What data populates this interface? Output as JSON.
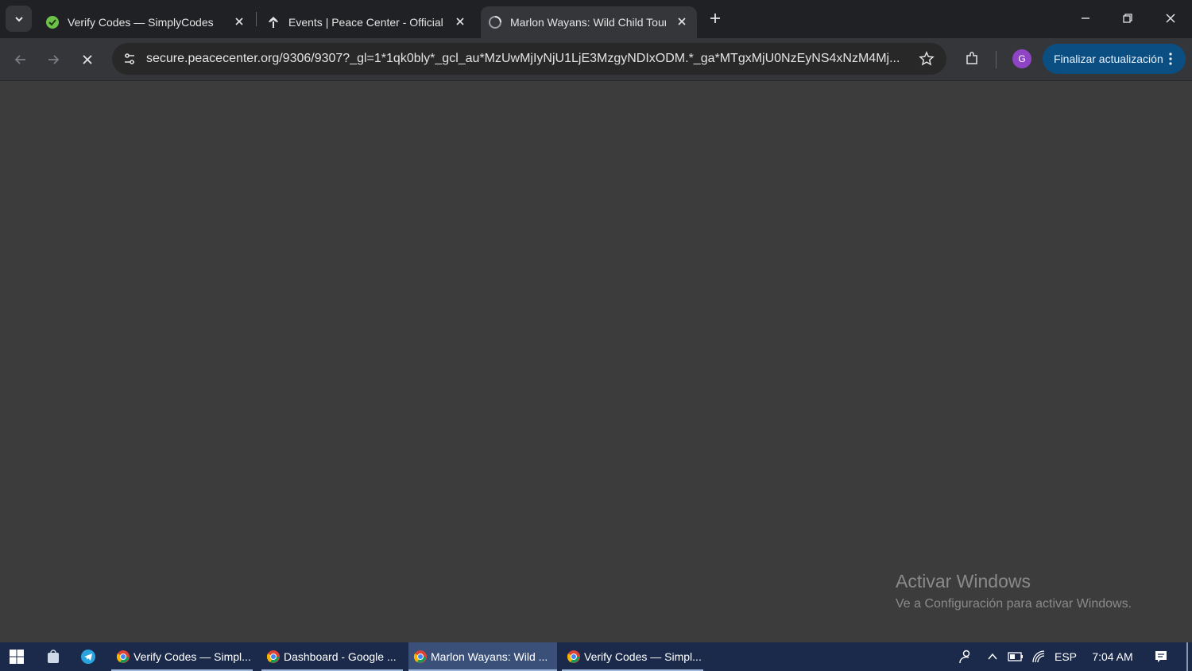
{
  "browser": {
    "tabs": [
      {
        "title": "Verify Codes — SimplyCodes",
        "favicon": "simplycodes-icon",
        "active": false
      },
      {
        "title": "Events | Peace Center - Official Site",
        "favicon": "peace-center-icon",
        "active": false
      },
      {
        "title": "Marlon Wayans: Wild Child Tour",
        "favicon": "loading-globe-icon",
        "active": true
      }
    ],
    "url": "secure.peacecenter.org/9306/9307?_gl=1*1qk0bly*_gcl_au*MzUwMjIyNjU1LjE3MzgyNDIxODM.*_ga*MTgxMjU0NzEyNS4xNzM4Mj...",
    "avatar_letter": "G",
    "update_label": "Finalizar actualización",
    "colors": {
      "accent": "#0b4f82",
      "avatar": "#8e44c5",
      "page_bg": "#3c3c3c"
    }
  },
  "watermark": {
    "title": "Activar Windows",
    "subtitle": "Ve a Configuración para activar Windows."
  },
  "taskbar": {
    "items": [
      {
        "label": "Verify Codes — Simpl...",
        "active": false
      },
      {
        "label": "Dashboard - Google ...",
        "active": false
      },
      {
        "label": "Marlon Wayans: Wild ...",
        "active": true
      },
      {
        "label": "Verify Codes — Simpl...",
        "active": false
      }
    ],
    "language": "ESP",
    "time": "7:04 AM"
  }
}
